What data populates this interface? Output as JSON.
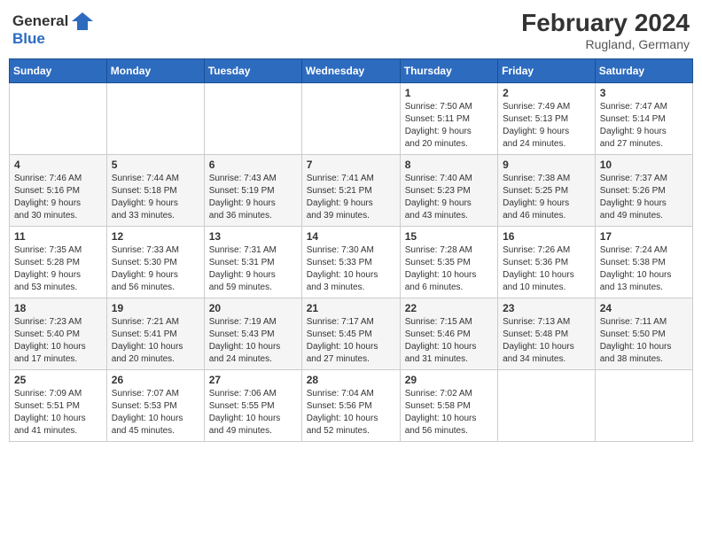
{
  "header": {
    "logo_general": "General",
    "logo_blue": "Blue",
    "month_year": "February 2024",
    "location": "Rugland, Germany"
  },
  "days_of_week": [
    "Sunday",
    "Monday",
    "Tuesday",
    "Wednesday",
    "Thursday",
    "Friday",
    "Saturday"
  ],
  "weeks": [
    [
      {
        "day": "",
        "info": ""
      },
      {
        "day": "",
        "info": ""
      },
      {
        "day": "",
        "info": ""
      },
      {
        "day": "",
        "info": ""
      },
      {
        "day": "1",
        "info": "Sunrise: 7:50 AM\nSunset: 5:11 PM\nDaylight: 9 hours\nand 20 minutes."
      },
      {
        "day": "2",
        "info": "Sunrise: 7:49 AM\nSunset: 5:13 PM\nDaylight: 9 hours\nand 24 minutes."
      },
      {
        "day": "3",
        "info": "Sunrise: 7:47 AM\nSunset: 5:14 PM\nDaylight: 9 hours\nand 27 minutes."
      }
    ],
    [
      {
        "day": "4",
        "info": "Sunrise: 7:46 AM\nSunset: 5:16 PM\nDaylight: 9 hours\nand 30 minutes."
      },
      {
        "day": "5",
        "info": "Sunrise: 7:44 AM\nSunset: 5:18 PM\nDaylight: 9 hours\nand 33 minutes."
      },
      {
        "day": "6",
        "info": "Sunrise: 7:43 AM\nSunset: 5:19 PM\nDaylight: 9 hours\nand 36 minutes."
      },
      {
        "day": "7",
        "info": "Sunrise: 7:41 AM\nSunset: 5:21 PM\nDaylight: 9 hours\nand 39 minutes."
      },
      {
        "day": "8",
        "info": "Sunrise: 7:40 AM\nSunset: 5:23 PM\nDaylight: 9 hours\nand 43 minutes."
      },
      {
        "day": "9",
        "info": "Sunrise: 7:38 AM\nSunset: 5:25 PM\nDaylight: 9 hours\nand 46 minutes."
      },
      {
        "day": "10",
        "info": "Sunrise: 7:37 AM\nSunset: 5:26 PM\nDaylight: 9 hours\nand 49 minutes."
      }
    ],
    [
      {
        "day": "11",
        "info": "Sunrise: 7:35 AM\nSunset: 5:28 PM\nDaylight: 9 hours\nand 53 minutes."
      },
      {
        "day": "12",
        "info": "Sunrise: 7:33 AM\nSunset: 5:30 PM\nDaylight: 9 hours\nand 56 minutes."
      },
      {
        "day": "13",
        "info": "Sunrise: 7:31 AM\nSunset: 5:31 PM\nDaylight: 9 hours\nand 59 minutes."
      },
      {
        "day": "14",
        "info": "Sunrise: 7:30 AM\nSunset: 5:33 PM\nDaylight: 10 hours\nand 3 minutes."
      },
      {
        "day": "15",
        "info": "Sunrise: 7:28 AM\nSunset: 5:35 PM\nDaylight: 10 hours\nand 6 minutes."
      },
      {
        "day": "16",
        "info": "Sunrise: 7:26 AM\nSunset: 5:36 PM\nDaylight: 10 hours\nand 10 minutes."
      },
      {
        "day": "17",
        "info": "Sunrise: 7:24 AM\nSunset: 5:38 PM\nDaylight: 10 hours\nand 13 minutes."
      }
    ],
    [
      {
        "day": "18",
        "info": "Sunrise: 7:23 AM\nSunset: 5:40 PM\nDaylight: 10 hours\nand 17 minutes."
      },
      {
        "day": "19",
        "info": "Sunrise: 7:21 AM\nSunset: 5:41 PM\nDaylight: 10 hours\nand 20 minutes."
      },
      {
        "day": "20",
        "info": "Sunrise: 7:19 AM\nSunset: 5:43 PM\nDaylight: 10 hours\nand 24 minutes."
      },
      {
        "day": "21",
        "info": "Sunrise: 7:17 AM\nSunset: 5:45 PM\nDaylight: 10 hours\nand 27 minutes."
      },
      {
        "day": "22",
        "info": "Sunrise: 7:15 AM\nSunset: 5:46 PM\nDaylight: 10 hours\nand 31 minutes."
      },
      {
        "day": "23",
        "info": "Sunrise: 7:13 AM\nSunset: 5:48 PM\nDaylight: 10 hours\nand 34 minutes."
      },
      {
        "day": "24",
        "info": "Sunrise: 7:11 AM\nSunset: 5:50 PM\nDaylight: 10 hours\nand 38 minutes."
      }
    ],
    [
      {
        "day": "25",
        "info": "Sunrise: 7:09 AM\nSunset: 5:51 PM\nDaylight: 10 hours\nand 41 minutes."
      },
      {
        "day": "26",
        "info": "Sunrise: 7:07 AM\nSunset: 5:53 PM\nDaylight: 10 hours\nand 45 minutes."
      },
      {
        "day": "27",
        "info": "Sunrise: 7:06 AM\nSunset: 5:55 PM\nDaylight: 10 hours\nand 49 minutes."
      },
      {
        "day": "28",
        "info": "Sunrise: 7:04 AM\nSunset: 5:56 PM\nDaylight: 10 hours\nand 52 minutes."
      },
      {
        "day": "29",
        "info": "Sunrise: 7:02 AM\nSunset: 5:58 PM\nDaylight: 10 hours\nand 56 minutes."
      },
      {
        "day": "",
        "info": ""
      },
      {
        "day": "",
        "info": ""
      }
    ]
  ]
}
